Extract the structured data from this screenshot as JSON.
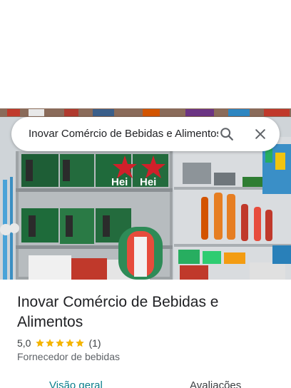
{
  "search": {
    "query": "Inovar Comércio de Bebidas e Alimentos",
    "search_icon": "search-icon",
    "clear_icon": "close-icon"
  },
  "hero": {
    "photo_description_icon": "store-photo",
    "can_brand_text": "Hei"
  },
  "place": {
    "title": "Inovar Comércio de Bebidas e Alimentos",
    "rating_value": "5,0",
    "rating_stars": 5,
    "rating_count": "(1)",
    "category": "Fornecedor de bebidas"
  },
  "tabs": [
    {
      "label": "Visão geral",
      "selected": true
    },
    {
      "label": "Avaliações",
      "selected": false
    }
  ],
  "colors": {
    "accent": "#0b7f8c",
    "star": "#f4b400",
    "text": "#202124",
    "secondary_text": "#5f6368"
  }
}
